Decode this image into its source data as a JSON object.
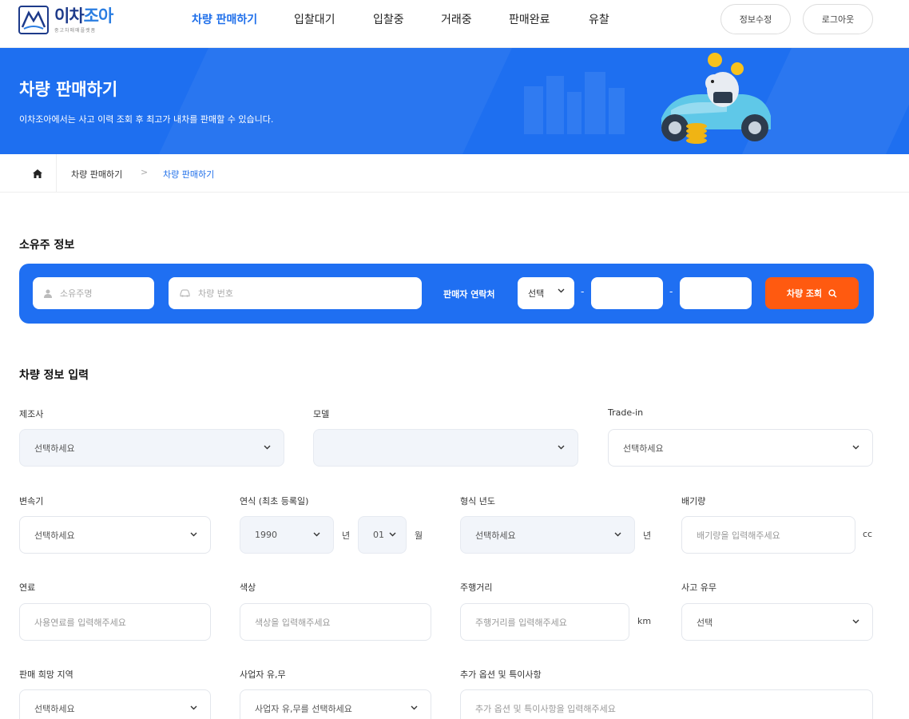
{
  "header": {
    "logo_text_a": "이차",
    "logo_text_b": "조아",
    "logo_sub": "중고차매매플랫폼",
    "nav": [
      {
        "label": "차량 판매하기",
        "active": true
      },
      {
        "label": "입찰대기",
        "active": false
      },
      {
        "label": "입찰중",
        "active": false
      },
      {
        "label": "거래중",
        "active": false
      },
      {
        "label": "판매완료",
        "active": false
      },
      {
        "label": "유찰",
        "active": false
      }
    ],
    "edit_profile_label": "정보수정",
    "logout_label": "로그아웃"
  },
  "banner": {
    "title": "차량 판매하기",
    "subtitle": "이차조아에서는 사고 이력 조회 후 최고가 내차를 판매할 수 있습니다."
  },
  "breadcrumb": {
    "level1": "차량 판매하기",
    "separator": ">",
    "level2": "차량 판매하기"
  },
  "owner_section": {
    "title": "소유주 정보",
    "owner_name_placeholder": "소유주명",
    "car_number_placeholder": "차량 번호",
    "seller_contact_label": "판매자 연락처",
    "phone_prefix_value": "선택",
    "phone_separator": "-",
    "search_button_label": "차량 조회"
  },
  "vehicle_section": {
    "title": "차량 정보 입력",
    "manufacturer": {
      "label": "제조사",
      "value": "선택하세요"
    },
    "model": {
      "label": "모델",
      "value": ""
    },
    "trade_in": {
      "label": "Trade-in",
      "value": "선택하세요"
    },
    "transmission": {
      "label": "변속기",
      "value": "선택하세요"
    },
    "year": {
      "label": "연식 (최초 등록일)",
      "year_value": "1990",
      "year_unit": "년",
      "month_value": "01",
      "month_unit": "월"
    },
    "model_year": {
      "label": "형식 년도",
      "value": "선택하세요",
      "unit": "년"
    },
    "displacement": {
      "label": "배기량",
      "placeholder": "배기량을 입력해주세요",
      "unit": "cc"
    },
    "fuel": {
      "label": "연료",
      "placeholder": "사용연료를 입력해주세요"
    },
    "color": {
      "label": "색상",
      "placeholder": "색상을 입력해주세요"
    },
    "mileage": {
      "label": "주행거리",
      "placeholder": "주행거리를 입력해주세요",
      "unit": "km"
    },
    "accident": {
      "label": "사고 유무",
      "value": "선택"
    },
    "region": {
      "label": "판매 희망 지역",
      "value": "선택하세요"
    },
    "business": {
      "label": "사업자 유,무",
      "value": "사업자 유,무를 선택하세요"
    },
    "options": {
      "label": "추가 옵션 및 특이사항",
      "placeholder": "추가 옵션 및 특이사항을 입력해주세요"
    }
  },
  "colors": {
    "brand_blue": "#1e6ff0",
    "accent_orange": "#ff5a10",
    "nav_active": "#1f6fea"
  }
}
